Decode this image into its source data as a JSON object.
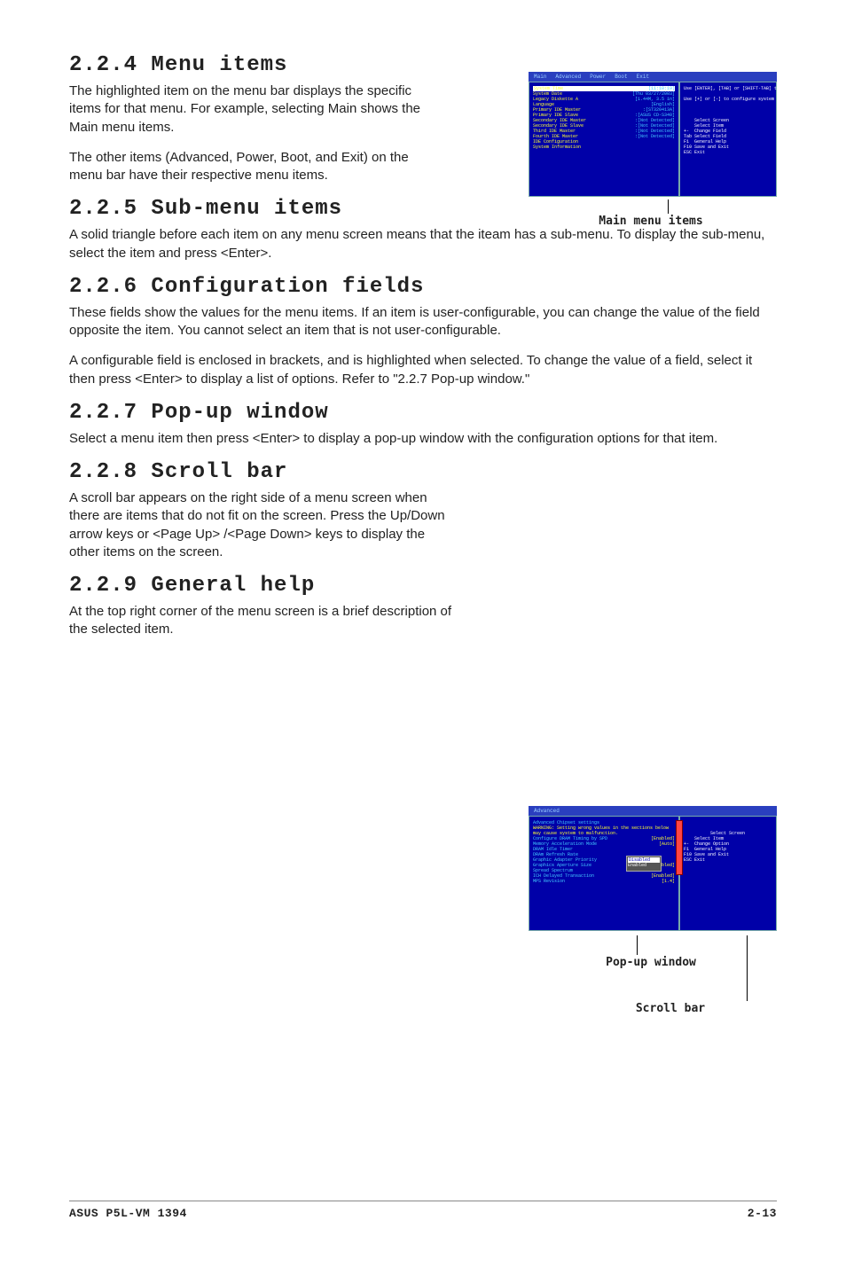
{
  "sections": {
    "s224": {
      "heading": "2.2.4  Menu items",
      "p1": "The highlighted item on the menu bar displays the specific items for that menu. For example, selecting Main shows the Main menu items.",
      "p2": "The other items (Advanced, Power, Boot, and Exit) on the menu bar have their respective menu items."
    },
    "s225": {
      "heading": "2.2.5  Sub-menu items",
      "p1": "A solid triangle before each item on any menu screen means that the iteam has a sub-menu. To display the sub-menu, select the item and press <Enter>."
    },
    "s226": {
      "heading": "2.2.6  Configuration fields",
      "p1": "These fields show the values for the menu items. If an item is user-configurable, you can change the value of the field opposite the item. You cannot select an item that is not user-configurable.",
      "p2": "A configurable field is enclosed in brackets, and is highlighted when selected. To change the value of a field, select it then press <Enter> to display a list of options. Refer to \"2.2.7 Pop-up window.\""
    },
    "s227": {
      "heading": "2.2.7  Pop-up window",
      "p1": "Select a menu item then press <Enter> to display a pop-up window with the configuration options for that item."
    },
    "s228": {
      "heading": "2.2.8  Scroll bar",
      "p1": "A scroll bar appears on the right side of a menu screen when there are items that do not fit on the screen. Press the Up/Down arrow keys or <Page Up> /<Page Down> keys to display the other items on the screen."
    },
    "s229": {
      "heading": "2.2.9  General help",
      "p1": "At the top right corner of the menu screen is a brief description of the selected item."
    }
  },
  "captions": {
    "main": "Main menu items",
    "popup": "Pop-up window",
    "scroll": "Scroll bar"
  },
  "footer": {
    "left": "ASUS P5L-VM 1394",
    "right": "2-13"
  },
  "bios_main": {
    "menubar": [
      "Main",
      "Advanced",
      "Power",
      "Boot",
      "Exit"
    ],
    "left_rows": [
      [
        "System Time",
        "[11:10:19]"
      ],
      [
        "System Date",
        "[Thu 03/27/2003]"
      ],
      [
        "Legacy Diskette A",
        "[1.44M, 3.5 in]"
      ],
      [
        "Language",
        "[English]"
      ],
      [
        "",
        ""
      ],
      [
        "  Primary IDE Master",
        ":[ST320413A]"
      ],
      [
        "  Primary IDE Slave",
        ":[ASUS CD-S340]"
      ],
      [
        "  Secondary IDE Master",
        ":[Not Detected]"
      ],
      [
        "  Secondary IDE Slave",
        ":[Not Detected]"
      ],
      [
        "  Third IDE Master",
        ":[Not Detected]"
      ],
      [
        "  Fourth IDE Master",
        ":[Not Detected]"
      ],
      [
        "  IDE Configuration",
        ""
      ],
      [
        "",
        ""
      ],
      [
        "  System Information",
        ""
      ]
    ],
    "right_text": "Use [ENTER], [TAB] or [SHIFT-TAB] to select a field.\n\nUse [+] or [-] to configure system time.\n\n\n\n    Select Screen\n    Select Item\n+-  Change Field\nTab Select Field\nF1  General Help\nF10 Save and Exit\nESC Exit"
  },
  "bios_adv": {
    "title": "Advanced Chipset settings",
    "warning": "WARNING: Setting wrong values in the sections below may cause system to malfunction.",
    "left_rows": [
      [
        "Configure DRAM Timing by SPD",
        "[Enabled]"
      ],
      [
        "Memory Acceleration Mode",
        "[Auto]"
      ],
      [
        "DRAM Idle Timer",
        ""
      ],
      [
        "DRAm Refresh Rate",
        ""
      ],
      [
        "",
        ""
      ],
      [
        "Graphic Adapter Priority",
        ""
      ],
      [
        "Graphics Aperture Size",
        "[Enabled]"
      ],
      [
        "Spread Spectrum",
        ""
      ],
      [
        "",
        ""
      ],
      [
        "ICH Delayed Transaction",
        "[Enabled]"
      ],
      [
        "",
        ""
      ],
      [
        "MPS Revision",
        "[1.4]"
      ]
    ],
    "popup_options": [
      "Disabled",
      "Enabled"
    ],
    "right_text": "    Select Screen\n    Select Item\n+-  Change Option\nF1  General Help\nF10 Save and Exit\nESC Exit"
  }
}
